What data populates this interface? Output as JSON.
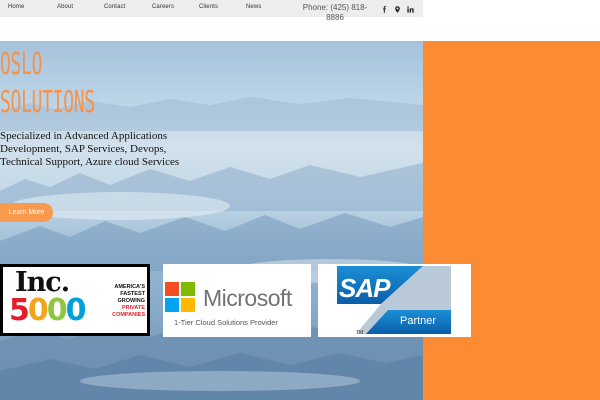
{
  "nav": {
    "items": [
      "Home",
      "About",
      "Contact",
      "Careers",
      "Clients",
      "News"
    ],
    "phone_line1": "Phone: (425) 818-",
    "phone_line2": "8886"
  },
  "social": [
    "facebook-icon",
    "map-pin-icon",
    "linkedin-icon"
  ],
  "hero": {
    "title_line1": "OSLO",
    "title_line2": "SOLUTIONS",
    "subtitle": "Specialized  in Advanced Applications Development, SAP Services, Devops, Technical Support, Azure cloud Services",
    "cta_label": "Learn More"
  },
  "badges": {
    "inc": {
      "word": "Inc.",
      "number": "5000",
      "tag_line1": "AMERICA'S",
      "tag_line2": "FASTEST",
      "tag_line3": "GROWING",
      "tag_line4": "PRIVATE",
      "tag_line5": "COMPANIES"
    },
    "microsoft": {
      "word": "Microsoft",
      "tag": "1-Tier Cloud Solutions Provider"
    },
    "sap": {
      "word": "SAP",
      "partner": "Partner",
      "tm": "TM"
    }
  },
  "colors": {
    "accent_orange": "#fb8c33",
    "title_orange": "#f5934a",
    "nav_bg": "#ededed",
    "sap_blue": "#1a6fc0"
  }
}
